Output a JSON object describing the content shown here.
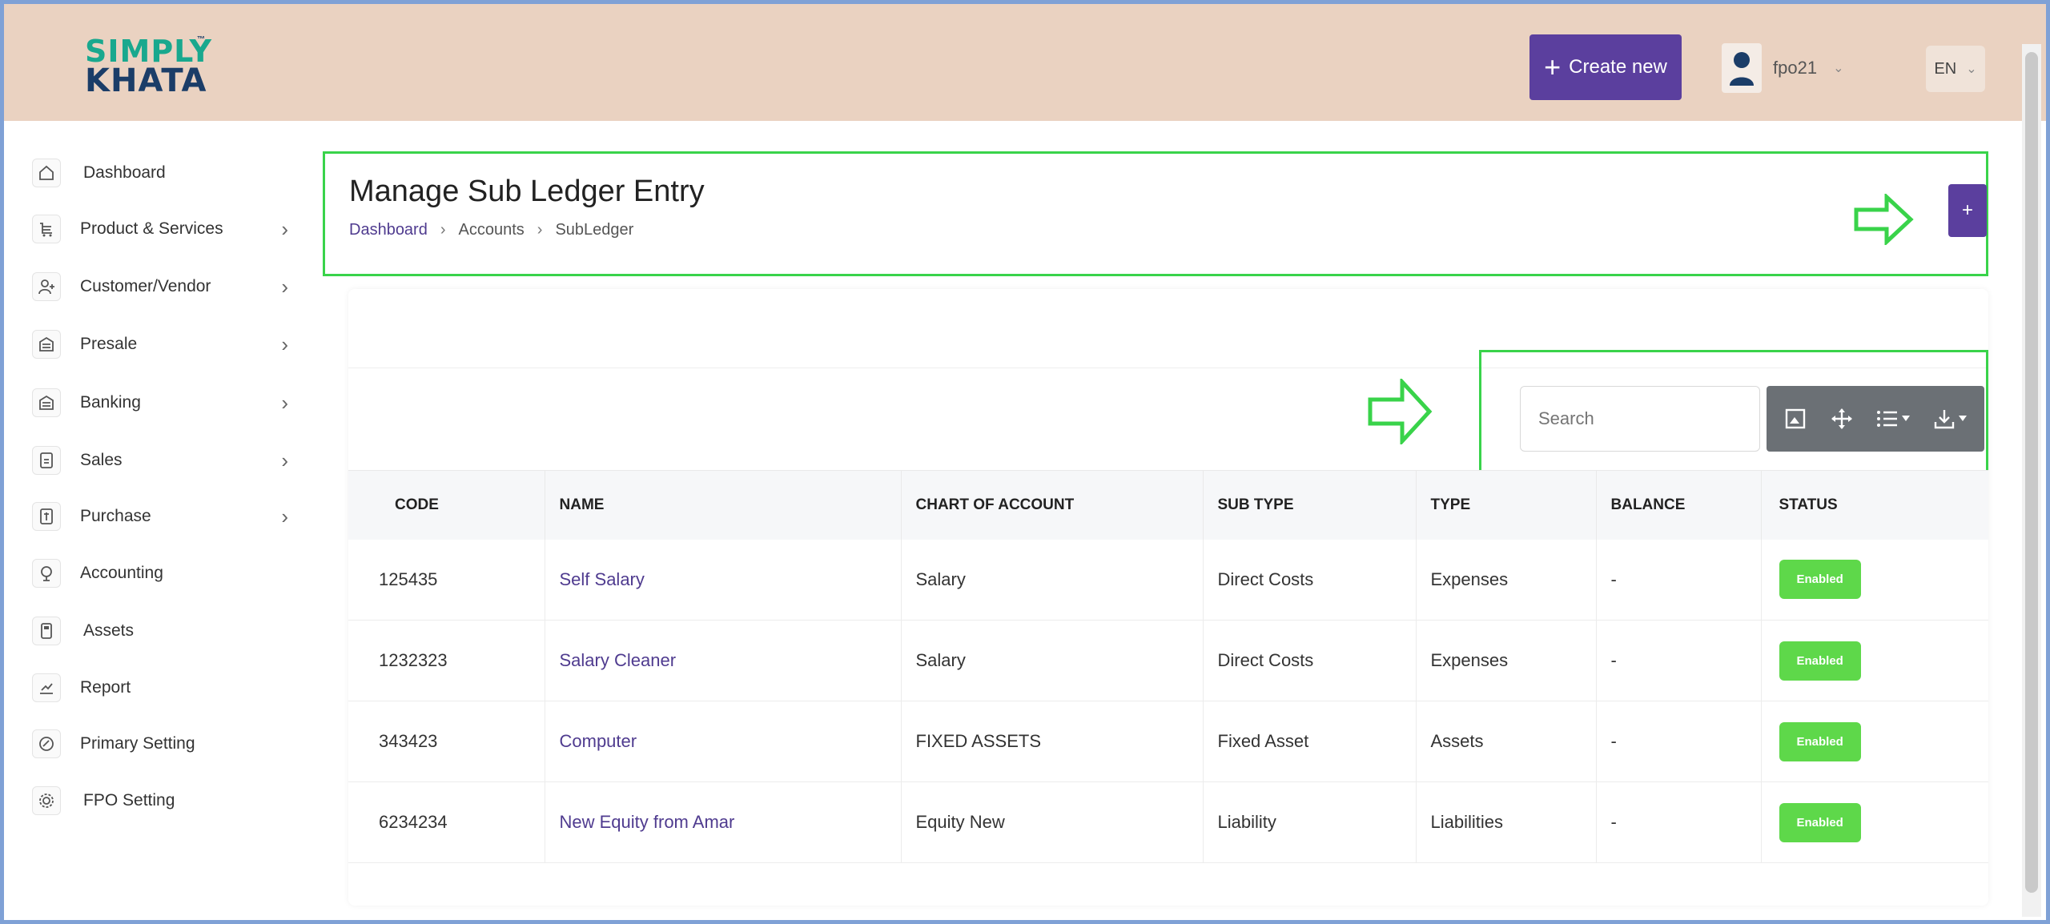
{
  "header": {
    "logo_line1": "SIMPLY",
    "logo_line2": "KHATA",
    "logo_tm": "™",
    "create_label": "Create new",
    "user_name": "fpo21",
    "lang": "EN"
  },
  "sidebar": {
    "items": [
      {
        "label": "Dashboard",
        "icon": "home-icon",
        "arrow": ""
      },
      {
        "label": "Product & Services",
        "icon": "cart-icon",
        "arrow": "›"
      },
      {
        "label": "Customer/Vendor",
        "icon": "user-plus-icon",
        "arrow": "›"
      },
      {
        "label": "Presale",
        "icon": "building-icon",
        "arrow": "›"
      },
      {
        "label": "Banking",
        "icon": "bank-icon",
        "arrow": "›"
      },
      {
        "label": "Sales",
        "icon": "sales-doc-icon",
        "arrow": "›"
      },
      {
        "label": "Purchase",
        "icon": "purchase-icon",
        "arrow": "›"
      },
      {
        "label": "Accounting",
        "icon": "accounting-icon",
        "arrow": ""
      },
      {
        "label": "Assets",
        "icon": "assets-icon",
        "arrow": ""
      },
      {
        "label": "Report",
        "icon": "report-icon",
        "arrow": ""
      },
      {
        "label": "Primary Setting",
        "icon": "primary-setting-icon",
        "arrow": ""
      },
      {
        "label": "FPO Setting",
        "icon": "gear-icon",
        "arrow": ""
      }
    ]
  },
  "page": {
    "title": "Manage Sub Ledger Entry",
    "breadcrumb": [
      "Dashboard",
      "Accounts",
      "SubLedger"
    ],
    "breadcrumb_sep": "›",
    "add_label": "+"
  },
  "tools": {
    "search_placeholder": "Search"
  },
  "table": {
    "columns": [
      "CODE",
      "NAME",
      "CHART OF ACCOUNT",
      "SUB TYPE",
      "TYPE",
      "BALANCE",
      "STATUS"
    ],
    "rows": [
      {
        "code": "125435",
        "name": "Self Salary",
        "chart": "Salary",
        "subtype": "Direct Costs",
        "type": "Expenses",
        "balance": "-",
        "status": "Enabled"
      },
      {
        "code": "1232323",
        "name": "Salary Cleaner",
        "chart": "Salary",
        "subtype": "Direct Costs",
        "type": "Expenses",
        "balance": "-",
        "status": "Enabled"
      },
      {
        "code": "343423",
        "name": "Computer",
        "chart": "FIXED ASSETS",
        "subtype": "Fixed Asset",
        "type": "Assets",
        "balance": "-",
        "status": "Enabled"
      },
      {
        "code": "6234234",
        "name": "New Equity from Amar",
        "chart": "Equity New",
        "subtype": "Liability",
        "type": "Liabilities",
        "balance": "-",
        "status": "Enabled"
      }
    ]
  },
  "colors": {
    "header_bg": "#ead2c1",
    "accent": "#5b3f9e",
    "highlight": "#39d34a",
    "status_enabled": "#5ed84a"
  }
}
